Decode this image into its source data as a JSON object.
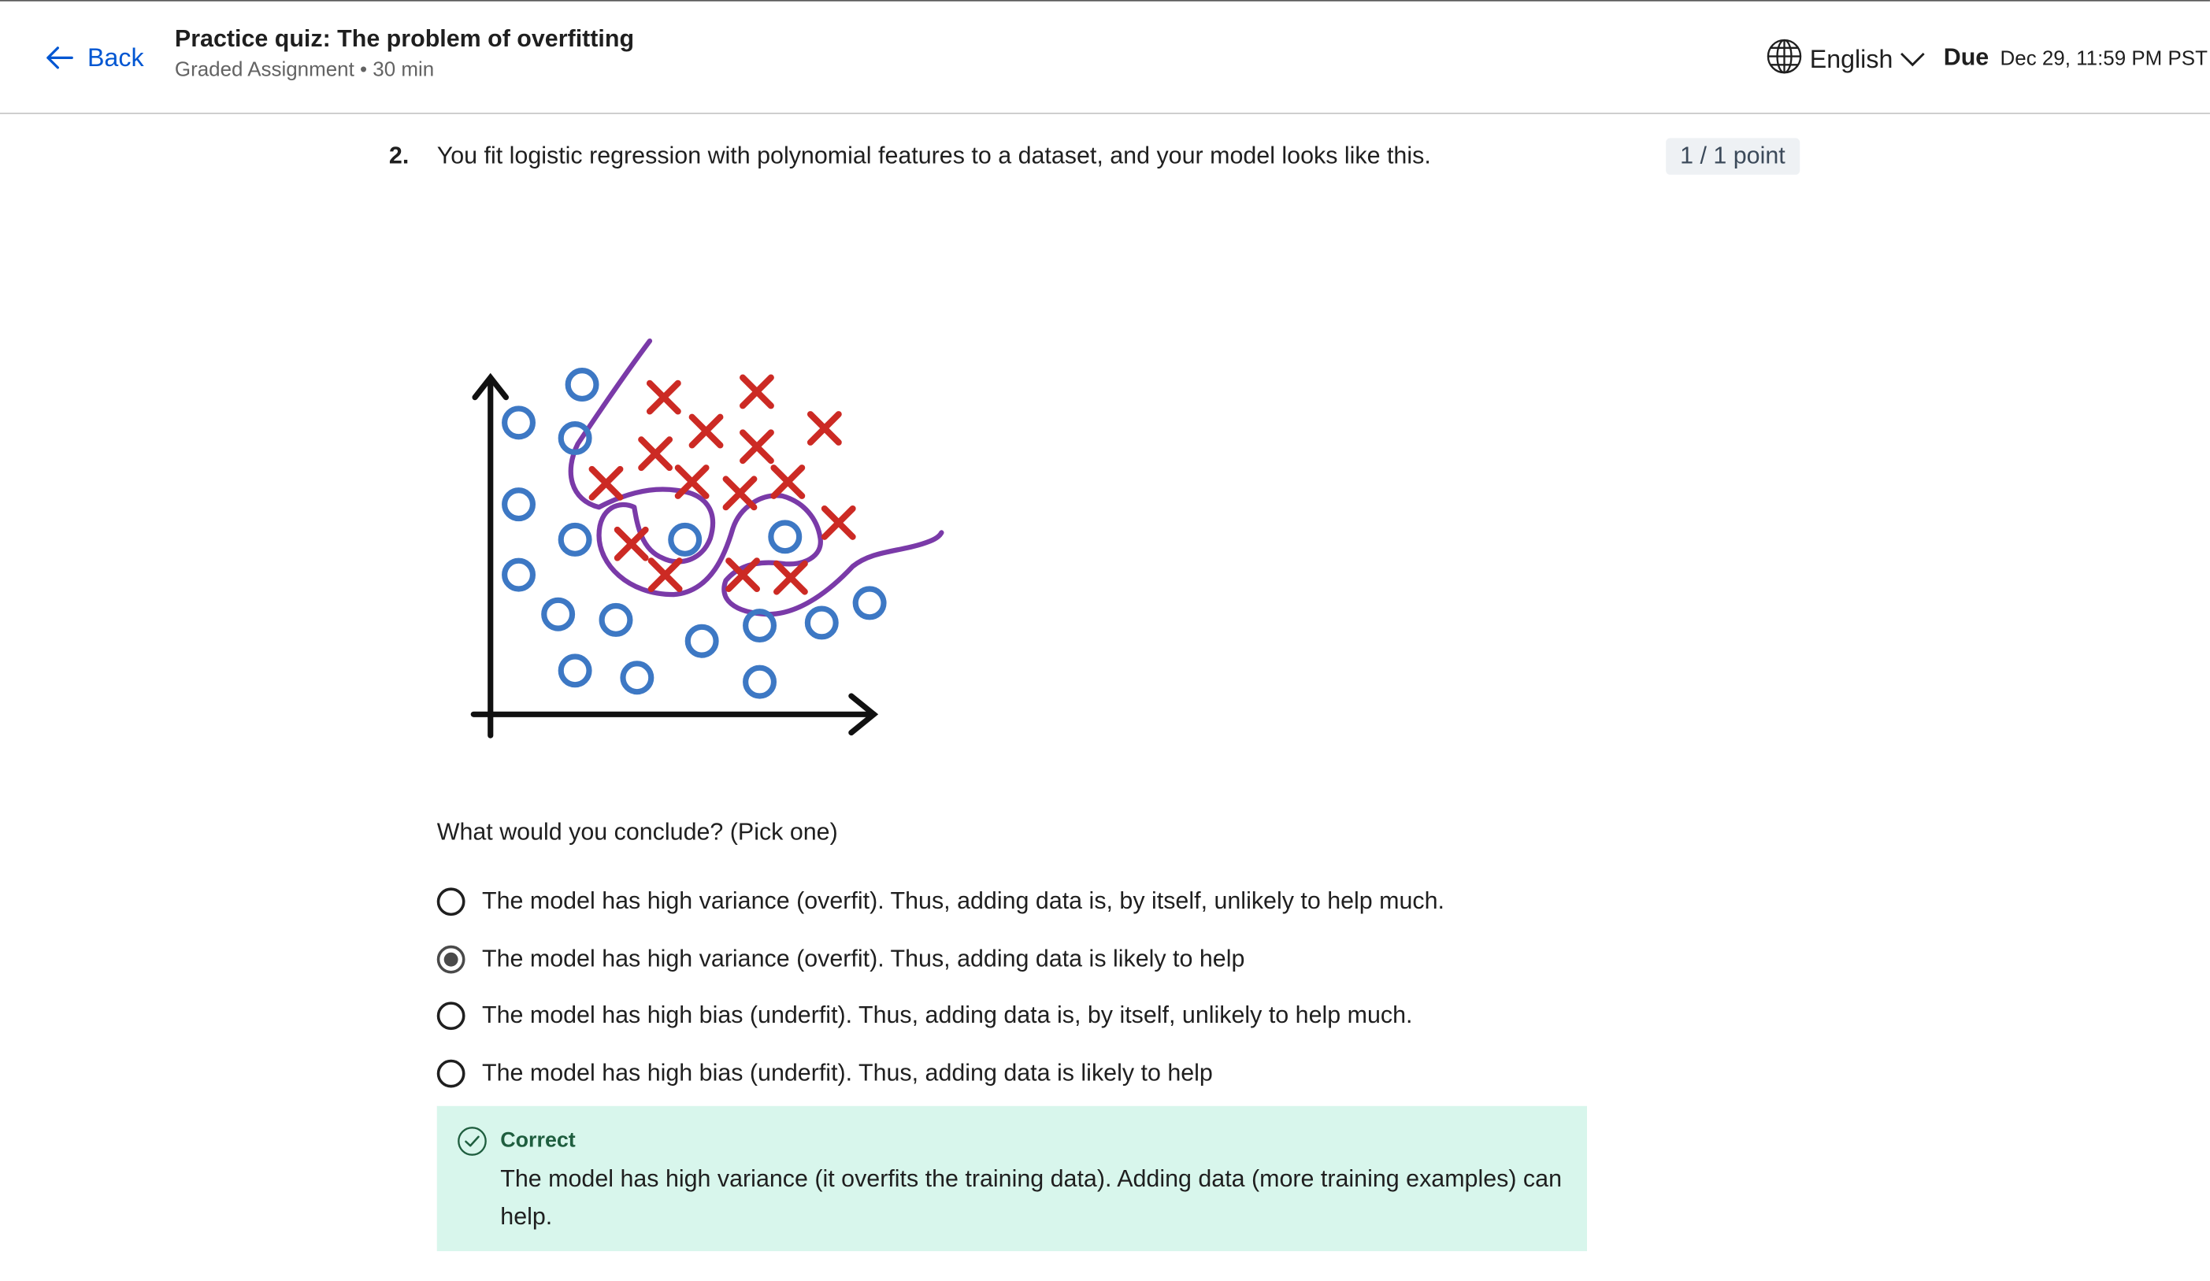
{
  "header": {
    "back_label": "Back",
    "title": "Practice quiz: The problem of overfitting",
    "subtitle": "Graded Assignment • 30 min",
    "language": "English",
    "due_label": "Due",
    "due_value": "Dec 29, 11:59 PM PST"
  },
  "question": {
    "number": "2.",
    "text": "You fit logistic regression with polynomial features to a dataset, and your model looks like this.",
    "points": "1 / 1 point",
    "prompt": "What would you conclude? (Pick one)",
    "options": [
      {
        "label": "The model has high variance (overfit). Thus, adding data is, by itself, unlikely to help much.",
        "selected": false
      },
      {
        "label": "The model has high variance (overfit). Thus, adding data is likely to help",
        "selected": true
      },
      {
        "label": "The model has high bias (underfit). Thus, adding data is, by itself, unlikely to help much.",
        "selected": false
      },
      {
        "label": "The model has high bias (underfit). Thus, adding data is likely to help",
        "selected": false
      }
    ]
  },
  "feedback": {
    "status": "Correct",
    "text": "The model has high variance (it overfits the training data). Adding data (more training examples) can help."
  },
  "colors": {
    "accent": "#0056d2",
    "circle_marker": "#3d78c4",
    "cross_marker": "#cc2a24",
    "boundary": "#7a3aa8",
    "feedback_bg": "#d8f6ec"
  },
  "icons": {
    "back": "arrow-left-icon",
    "language": "globe-icon",
    "dropdown": "chevron-down-icon",
    "correct": "check-circle-icon"
  }
}
